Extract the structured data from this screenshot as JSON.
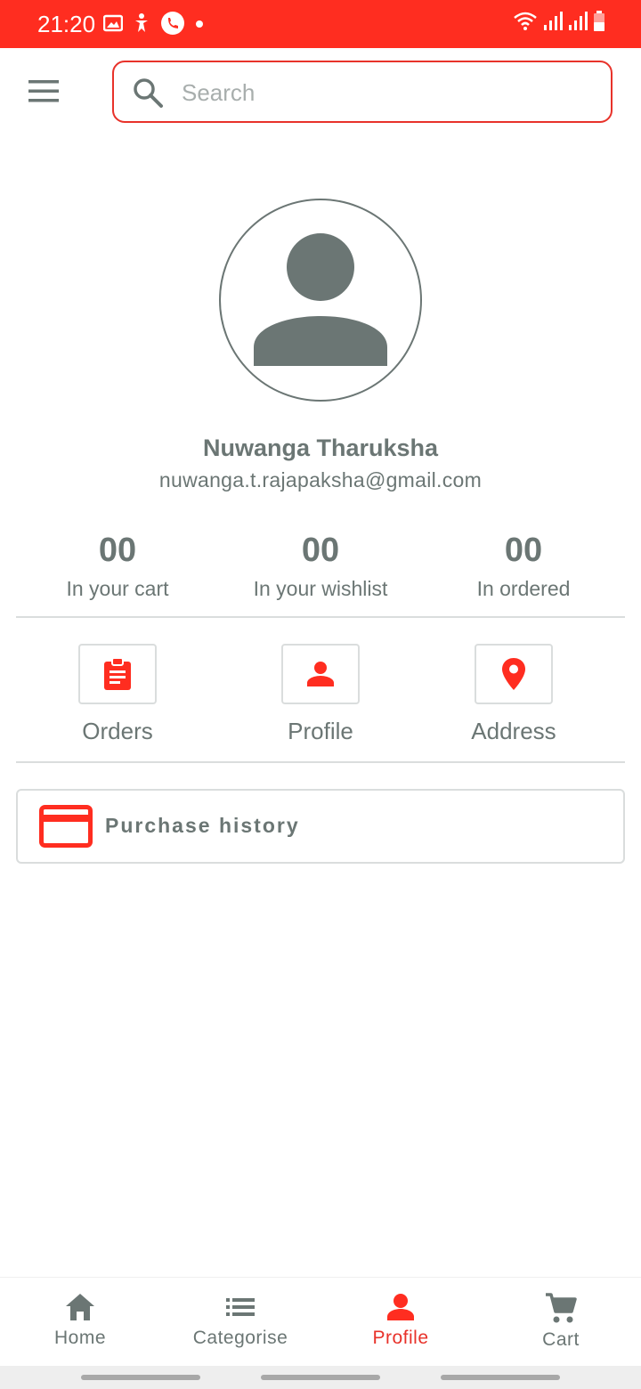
{
  "status_bar": {
    "time": "21:20",
    "background": "#ff2d20",
    "left_icons": [
      "image-icon",
      "accessibility-icon",
      "phone-call-icon",
      "notification-dot-icon"
    ],
    "right_icons": [
      "wifi-calling-icon",
      "signal-icon",
      "signal-icon",
      "battery-low-icon"
    ]
  },
  "header": {
    "menu_icon": "hamburger-menu-icon",
    "search": {
      "placeholder": "Search",
      "value": "",
      "icon": "search-icon"
    }
  },
  "profile": {
    "avatar_icon": "person-avatar-icon",
    "name": "Nuwanga Tharuksha",
    "email": "nuwanga.t.rajapaksha@gmail.com"
  },
  "stats": [
    {
      "value": "00",
      "label": "In your cart"
    },
    {
      "value": "00",
      "label": "In your wishlist"
    },
    {
      "value": "00",
      "label": "In ordered"
    }
  ],
  "actions": [
    {
      "label": "Orders",
      "icon": "clipboard-icon"
    },
    {
      "label": "Profile",
      "icon": "person-icon"
    },
    {
      "label": "Address",
      "icon": "location-pin-icon"
    }
  ],
  "purchase_history": {
    "label": "Purchase history",
    "icon": "credit-card-icon"
  },
  "bottom_nav": {
    "active": "Profile",
    "items": [
      {
        "label": "Home",
        "icon": "home-icon"
      },
      {
        "label": "Categorise",
        "icon": "list-icon"
      },
      {
        "label": "Profile",
        "icon": "person-icon"
      },
      {
        "label": "Cart",
        "icon": "cart-icon"
      }
    ]
  },
  "colors": {
    "accent": "#e8322a",
    "text": "#6b7674",
    "border": "#dadddd"
  }
}
